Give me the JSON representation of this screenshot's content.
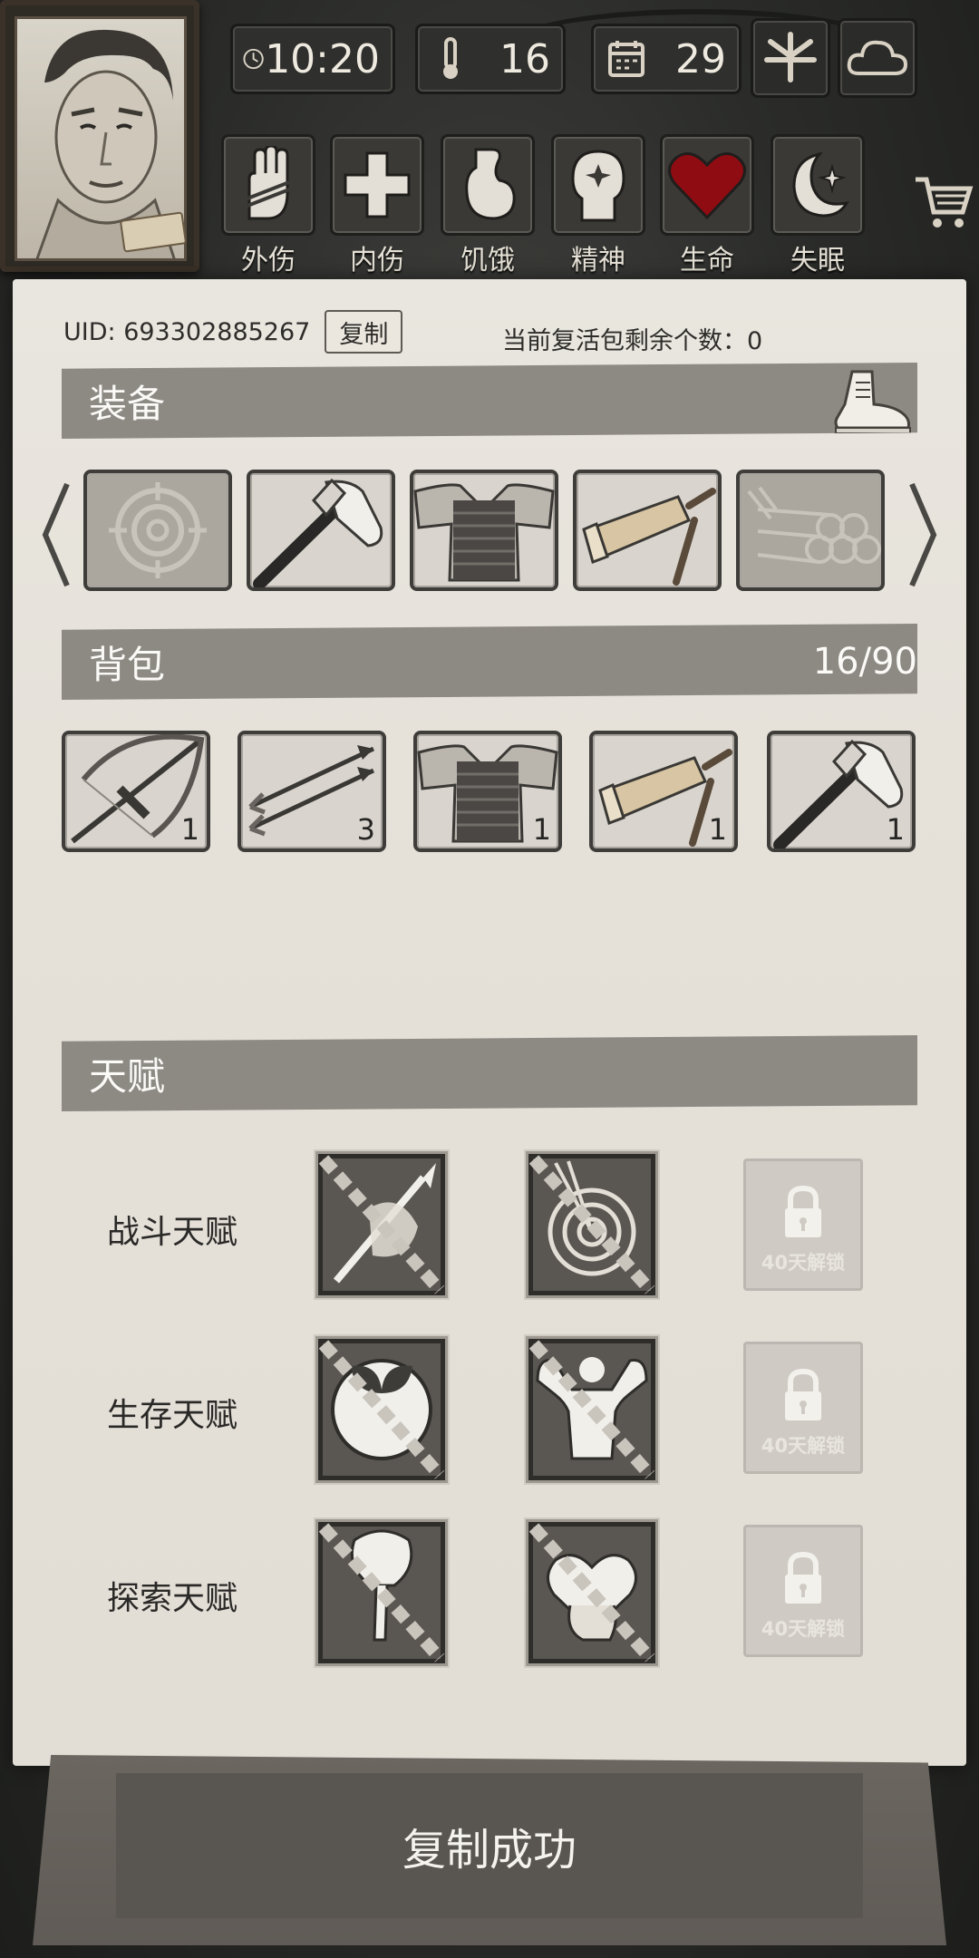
{
  "hud": {
    "time": "10:20",
    "temperature": "16",
    "day": "29",
    "status": [
      {
        "label": "外伤",
        "icon": "hand-wound-icon"
      },
      {
        "label": "内伤",
        "icon": "cross-icon"
      },
      {
        "label": "饥饿",
        "icon": "stomach-icon"
      },
      {
        "label": "精神",
        "icon": "head-spark-icon"
      },
      {
        "label": "生命",
        "icon": "heart-icon"
      },
      {
        "label": "失眠",
        "icon": "moon-star-icon"
      }
    ]
  },
  "account": {
    "uid_label": "UID: 693302885267",
    "copy_label": "复制",
    "revive_text": "当前复活包剩余个数：0"
  },
  "equipment": {
    "title": "装备",
    "slots": [
      {
        "item": "target-icon",
        "empty": true
      },
      {
        "item": "axe-icon",
        "empty": false
      },
      {
        "item": "armor-vest-icon",
        "empty": false
      },
      {
        "item": "flashlight-icon",
        "empty": false
      },
      {
        "item": "logs-icon",
        "empty": true
      }
    ]
  },
  "backpack": {
    "title": "背包",
    "count": "16/90",
    "items": [
      {
        "item": "crossbow-icon",
        "qty": "1"
      },
      {
        "item": "arrows-icon",
        "qty": "3"
      },
      {
        "item": "armor-vest-icon",
        "qty": "1"
      },
      {
        "item": "flashlight-icon",
        "qty": "1"
      },
      {
        "item": "axe-icon",
        "qty": "1"
      }
    ]
  },
  "talents": {
    "title": "天赋",
    "rows": [
      {
        "label": "战斗天赋",
        "icons": [
          "spear-chain-icon",
          "target-chain-icon"
        ],
        "locked_text": "40天解锁"
      },
      {
        "label": "生存天赋",
        "icons": [
          "leaf-chain-icon",
          "muscle-chain-icon"
        ],
        "locked_text": "40天解锁"
      },
      {
        "label": "探索天赋",
        "icons": [
          "shovel-chain-icon",
          "heart-hand-chain-icon"
        ],
        "locked_text": "40天解锁"
      }
    ]
  },
  "toast": {
    "message": "复制成功"
  }
}
